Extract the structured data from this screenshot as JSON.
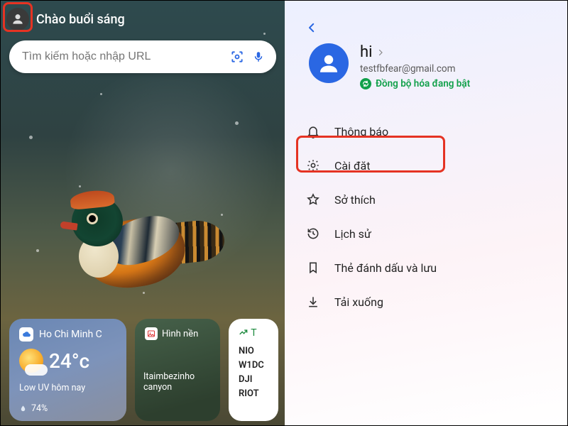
{
  "left": {
    "greeting": "Chào buổi sáng",
    "search_placeholder": "Tìm kiếm hoặc nhập URL",
    "weather": {
      "location": "Ho Chi Minh C",
      "temp": "24°c",
      "footer": "Low UV hôm nay",
      "humidity": "74%"
    },
    "wallpaper": {
      "title": "Hình nền",
      "caption": "Itaimbezinho canyon"
    },
    "stocks": {
      "header": "T",
      "tickers": [
        "NIO",
        "W1DC",
        "DJI",
        "RIOT"
      ]
    }
  },
  "right": {
    "name": "hi",
    "email": "testfbfear@gmail.com",
    "sync": "Đồng bộ hóa đang bật",
    "menu": [
      "Thông báo",
      "Cài đặt",
      "Sở thích",
      "Lịch sử",
      "Thẻ đánh dấu và lưu",
      "Tải xuống"
    ]
  }
}
